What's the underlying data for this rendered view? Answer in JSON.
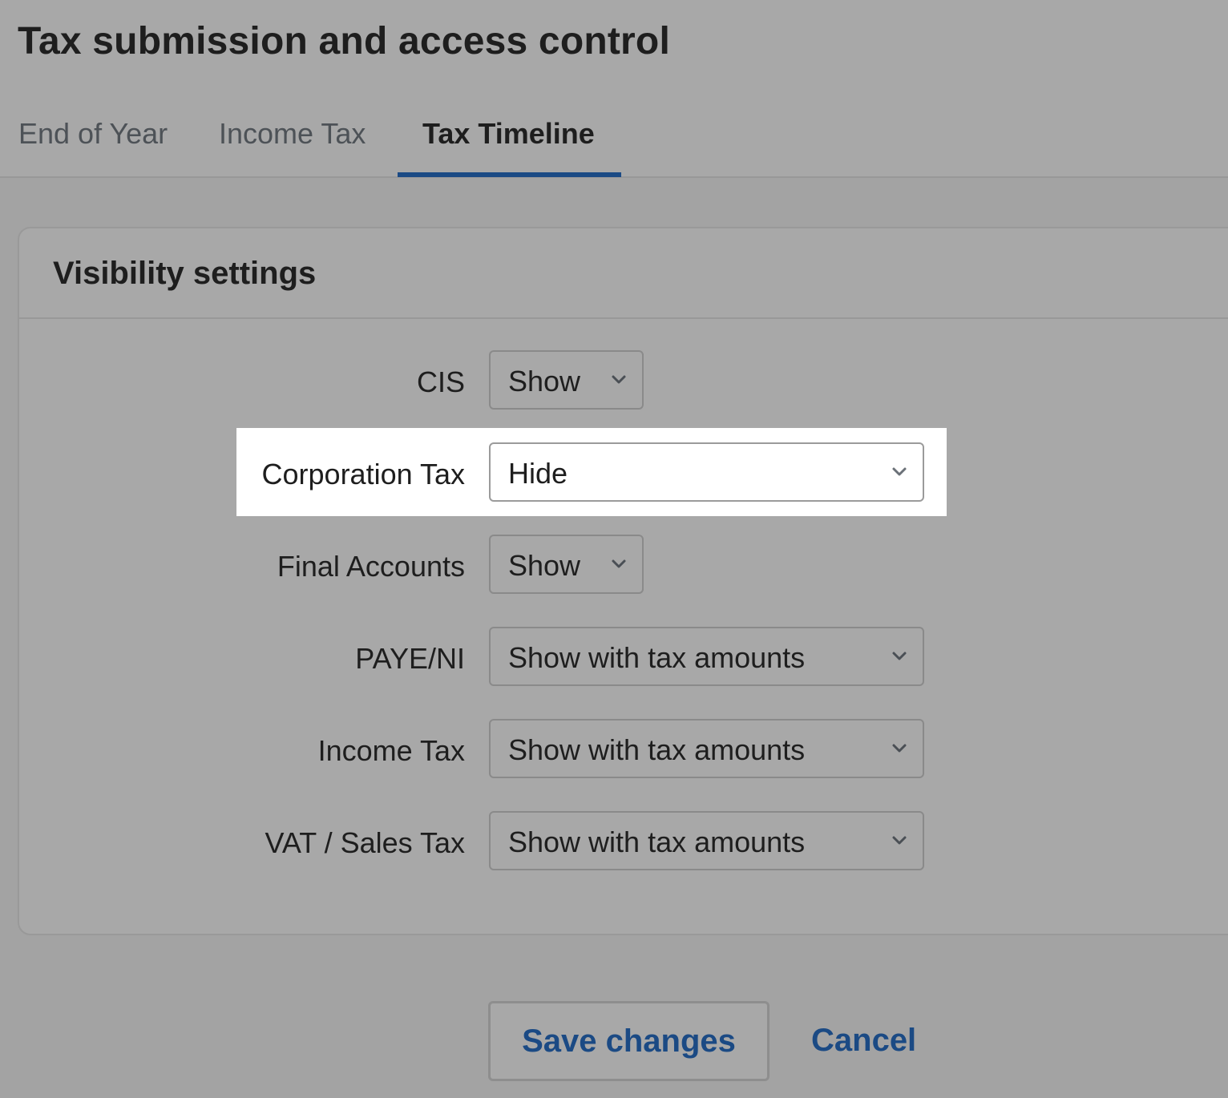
{
  "page": {
    "title": "Tax submission and access control"
  },
  "tabs": [
    {
      "label": "End of Year",
      "active": false
    },
    {
      "label": "Income Tax",
      "active": false
    },
    {
      "label": "Tax Timeline",
      "active": true
    }
  ],
  "card": {
    "title": "Visibility settings",
    "rows": [
      {
        "label": "CIS",
        "value": "Show"
      },
      {
        "label": "Corporation Tax",
        "value": "Hide",
        "highlighted": true
      },
      {
        "label": "Final Accounts",
        "value": "Show"
      },
      {
        "label": "PAYE/NI",
        "value": "Show with tax amounts"
      },
      {
        "label": "Income Tax",
        "value": "Show with tax amounts"
      },
      {
        "label": "VAT / Sales Tax",
        "value": "Show with tax amounts"
      }
    ]
  },
  "actions": {
    "save_label": "Save changes",
    "cancel_label": "Cancel"
  },
  "colors": {
    "accent": "#1b4a84",
    "overlay_background": "#a8a8a8",
    "highlight_background": "#ffffff"
  },
  "icons": {
    "select_chevron": "chevron-down-icon"
  }
}
